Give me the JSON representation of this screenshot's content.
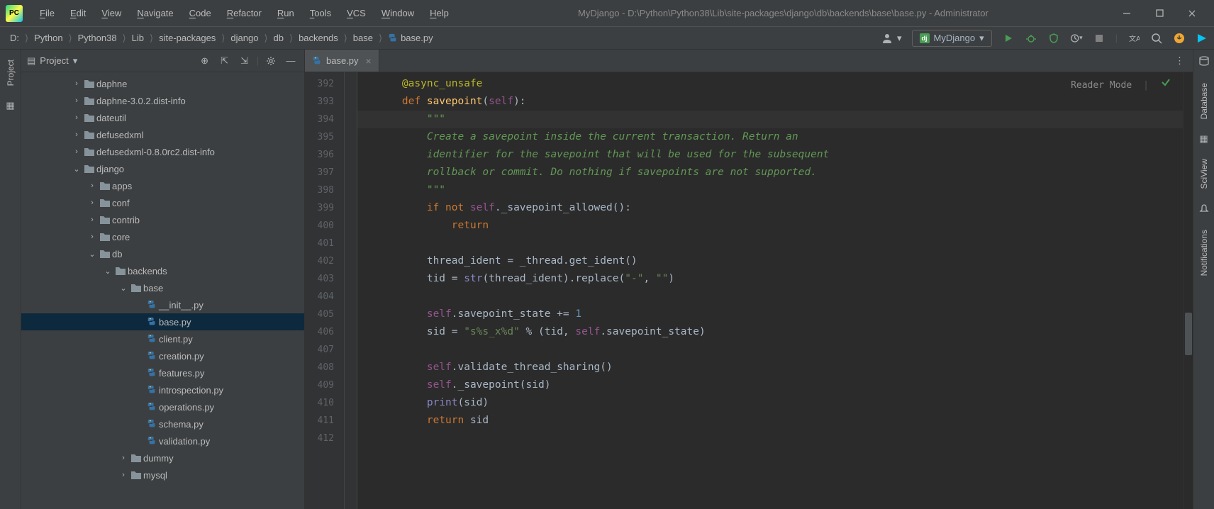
{
  "menu": [
    "File",
    "Edit",
    "View",
    "Navigate",
    "Code",
    "Refactor",
    "Run",
    "Tools",
    "VCS",
    "Window",
    "Help"
  ],
  "window_title": "MyDjango - D:\\Python\\Python38\\Lib\\site-packages\\django\\db\\backends\\base\\base.py - Administrator",
  "breadcrumbs": [
    "D:",
    "Python",
    "Python38",
    "Lib",
    "site-packages",
    "django",
    "db",
    "backends",
    "base",
    "base.py"
  ],
  "run_config_label": "MyDjango",
  "project_title": "Project",
  "reader_mode_label": "Reader Mode",
  "left_tool_label": "Project",
  "right_tool_labels": [
    "Database",
    "SciView",
    "Notifications"
  ],
  "tree": [
    {
      "depth": 0,
      "kind": "folder",
      "arrow": "right",
      "label": "daphne"
    },
    {
      "depth": 0,
      "kind": "folder",
      "arrow": "right",
      "label": "daphne-3.0.2.dist-info"
    },
    {
      "depth": 0,
      "kind": "folder",
      "arrow": "right",
      "label": "dateutil"
    },
    {
      "depth": 0,
      "kind": "folder",
      "arrow": "right",
      "label": "defusedxml"
    },
    {
      "depth": 0,
      "kind": "folder",
      "arrow": "right",
      "label": "defusedxml-0.8.0rc2.dist-info"
    },
    {
      "depth": 0,
      "kind": "folder",
      "arrow": "down",
      "label": "django"
    },
    {
      "depth": 1,
      "kind": "folder",
      "arrow": "right",
      "label": "apps"
    },
    {
      "depth": 1,
      "kind": "folder",
      "arrow": "right",
      "label": "conf"
    },
    {
      "depth": 1,
      "kind": "folder",
      "arrow": "right",
      "label": "contrib"
    },
    {
      "depth": 1,
      "kind": "folder",
      "arrow": "right",
      "label": "core"
    },
    {
      "depth": 1,
      "kind": "folder",
      "arrow": "down",
      "label": "db"
    },
    {
      "depth": 2,
      "kind": "folder",
      "arrow": "down",
      "label": "backends"
    },
    {
      "depth": 3,
      "kind": "folder",
      "arrow": "down",
      "label": "base"
    },
    {
      "depth": 4,
      "kind": "py",
      "arrow": "",
      "label": "__init__.py"
    },
    {
      "depth": 4,
      "kind": "py",
      "arrow": "",
      "label": "base.py",
      "selected": true
    },
    {
      "depth": 4,
      "kind": "py",
      "arrow": "",
      "label": "client.py"
    },
    {
      "depth": 4,
      "kind": "py",
      "arrow": "",
      "label": "creation.py"
    },
    {
      "depth": 4,
      "kind": "py",
      "arrow": "",
      "label": "features.py"
    },
    {
      "depth": 4,
      "kind": "py",
      "arrow": "",
      "label": "introspection.py"
    },
    {
      "depth": 4,
      "kind": "py",
      "arrow": "",
      "label": "operations.py"
    },
    {
      "depth": 4,
      "kind": "py",
      "arrow": "",
      "label": "schema.py"
    },
    {
      "depth": 4,
      "kind": "py",
      "arrow": "",
      "label": "validation.py"
    },
    {
      "depth": 3,
      "kind": "folder",
      "arrow": "right",
      "label": "dummy"
    },
    {
      "depth": 3,
      "kind": "folder",
      "arrow": "right",
      "label": "mysql"
    }
  ],
  "tab_file": "base.py",
  "code": {
    "first_line": 392,
    "current_line": 394,
    "lines": [
      {
        "n": 392,
        "html": "    <span class='c-decor'>@async_unsafe</span>"
      },
      {
        "n": 393,
        "html": "    <span class='c-kw'>def </span><span class='c-fn'>savepoint</span><span class='c-op'>(</span><span class='c-self'>self</span><span class='c-op'>):</span>"
      },
      {
        "n": 394,
        "html": "        <span class='c-doc'>\"\"\"</span>"
      },
      {
        "n": 395,
        "html": "        <span class='c-doc'>Create a savepoint inside the current transaction. Return an</span>"
      },
      {
        "n": 396,
        "html": "        <span class='c-doc'>identifier for the savepoint that will be used for the subsequent</span>"
      },
      {
        "n": 397,
        "html": "        <span class='c-doc'>rollback or commit. Do nothing if savepoints are not supported.</span>"
      },
      {
        "n": 398,
        "html": "        <span class='c-doc'>\"\"\"</span>"
      },
      {
        "n": 399,
        "html": "        <span class='c-kw'>if not </span><span class='c-self'>self</span><span class='c-plain'>._savepoint_allowed():</span>"
      },
      {
        "n": 400,
        "html": "            <span class='c-kw'>return</span>"
      },
      {
        "n": 401,
        "html": ""
      },
      {
        "n": 402,
        "html": "        <span class='c-plain'>thread_ident = _thread.get_ident()</span>"
      },
      {
        "n": 403,
        "html": "        <span class='c-plain'>tid = </span><span class='c-builtin'>str</span><span class='c-plain'>(thread_ident).replace(</span><span class='c-str'>\"-\"</span><span class='c-plain'>, </span><span class='c-str'>\"\"</span><span class='c-plain'>)</span>"
      },
      {
        "n": 404,
        "html": ""
      },
      {
        "n": 405,
        "html": "        <span class='c-self'>self</span><span class='c-plain'>.savepoint_state += </span><span class='c-num'>1</span>"
      },
      {
        "n": 406,
        "html": "        <span class='c-plain'>sid = </span><span class='c-str'>\"s%s_x%d\"</span><span class='c-plain'> % (tid, </span><span class='c-self'>self</span><span class='c-plain'>.savepoint_state)</span>"
      },
      {
        "n": 407,
        "html": ""
      },
      {
        "n": 408,
        "html": "        <span class='c-self'>self</span><span class='c-plain'>.validate_thread_sharing()</span>"
      },
      {
        "n": 409,
        "html": "        <span class='c-self'>self</span><span class='c-plain'>._savepoint(sid)</span>"
      },
      {
        "n": 410,
        "html": "        <span class='c-builtin'>print</span><span class='c-plain'>(sid)</span>"
      },
      {
        "n": 411,
        "html": "        <span class='c-kw'>return </span><span class='c-plain'>sid</span>"
      },
      {
        "n": 412,
        "html": ""
      }
    ]
  }
}
